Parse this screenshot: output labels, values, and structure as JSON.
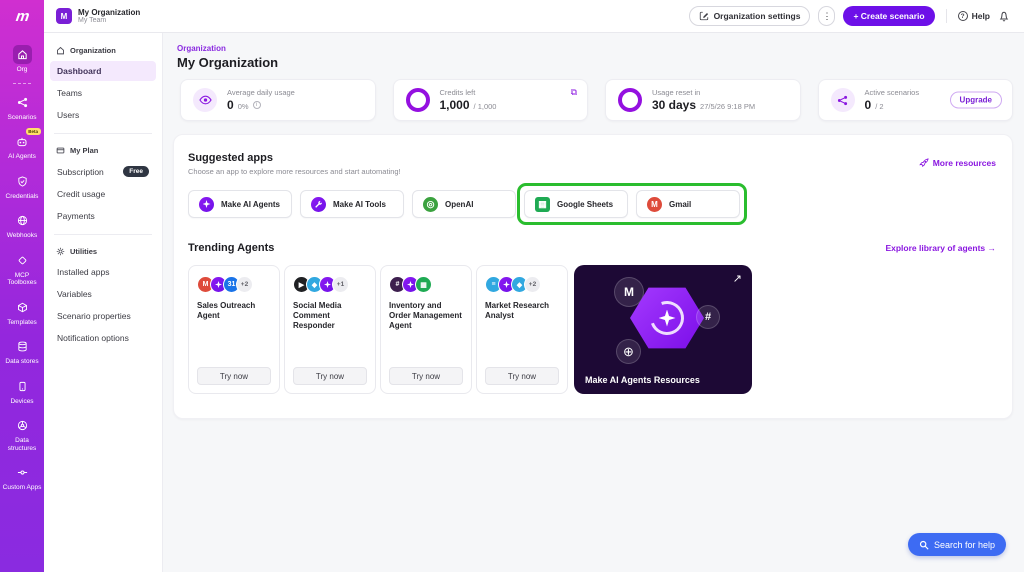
{
  "brand": {
    "logo": "m"
  },
  "rail": {
    "items": [
      {
        "label": "Org"
      },
      {
        "label": "Scenarios"
      },
      {
        "label": "AI Agents",
        "badge": "Beta"
      },
      {
        "label": "Credentials"
      },
      {
        "label": "Webhooks"
      },
      {
        "label": "MCP Toolboxes"
      },
      {
        "label": "Templates"
      },
      {
        "label": "Data stores"
      },
      {
        "label": "Devices"
      },
      {
        "label": "Data structures"
      },
      {
        "label": "Custom Apps"
      }
    ]
  },
  "org_switcher": {
    "name": "My Organization",
    "team": "My Team",
    "avatar": "M"
  },
  "header": {
    "org_settings": "Organization settings",
    "kebab": "⋮",
    "create_scenario": "+ Create scenario",
    "help": "Help"
  },
  "sidebar": {
    "section1": {
      "header": "Organization",
      "items": [
        {
          "label": "Dashboard"
        },
        {
          "label": "Teams"
        },
        {
          "label": "Users"
        }
      ]
    },
    "section2": {
      "header": "My Plan",
      "items": [
        {
          "label": "Subscription",
          "badge": "Free"
        },
        {
          "label": "Credit usage"
        },
        {
          "label": "Payments"
        }
      ]
    },
    "section3": {
      "header": "Utilities",
      "items": [
        {
          "label": "Installed apps"
        },
        {
          "label": "Variables"
        },
        {
          "label": "Scenario properties"
        },
        {
          "label": "Notification options"
        }
      ]
    }
  },
  "page": {
    "breadcrumb": "Organization",
    "title": "My Organization"
  },
  "stats": [
    {
      "label": "Average daily usage",
      "value": "0",
      "suffix": "0%"
    },
    {
      "label": "Credits left",
      "value": "1,000",
      "suffix": "/ 1,000"
    },
    {
      "label": "Usage reset in",
      "value": "30 days",
      "suffix": "27/5/26 9:18 PM"
    },
    {
      "label": "Active scenarios",
      "value": "0",
      "suffix": "/ 2",
      "action": "Upgrade"
    }
  ],
  "suggested": {
    "title": "Suggested apps",
    "subtitle": "Choose an app to explore more resources and start automating!",
    "more_link": "More resources",
    "apps": [
      {
        "name": "Make AI Agents"
      },
      {
        "name": "Make AI Tools"
      },
      {
        "name": "OpenAI"
      },
      {
        "name": "Google Sheets"
      },
      {
        "name": "Gmail"
      }
    ]
  },
  "trending": {
    "title": "Trending Agents",
    "link": "Explore library of agents →",
    "try_label": "Try now",
    "agents": [
      {
        "title": "Sales Outreach Agent",
        "extra": "+2"
      },
      {
        "title": "Social Media Comment Responder",
        "extra": "+1"
      },
      {
        "title": "Inventory and Order Management Agent"
      },
      {
        "title": "Market Research Analyst",
        "extra": "+2"
      }
    ],
    "banner": {
      "title": "Make AI Agents Resources"
    }
  },
  "help_button": {
    "label": "Search for help"
  },
  "colors": {
    "accent_purple": "#6d10e8",
    "link_purple": "#8a16e0",
    "annotation_green": "#2abd2e",
    "help_blue": "#3d6bf3",
    "rail_gradient_top": "#d02fd0",
    "rail_gradient_bottom": "#8a2be0"
  }
}
